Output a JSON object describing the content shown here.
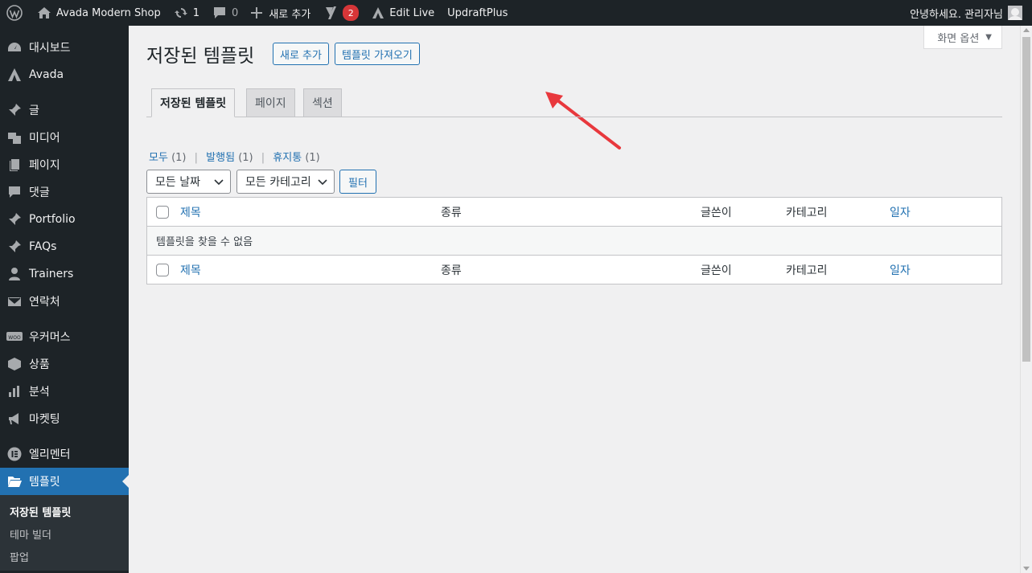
{
  "adminbar": {
    "site_name": "Avada Modern Shop",
    "updates_count": "1",
    "comments_count": "0",
    "new_label": "새로 추가",
    "yoast_badge": "2",
    "edit_live": "Edit Live",
    "updraft": "UpdraftPlus",
    "greeting": "안녕하세요. 관리자님"
  },
  "sidebar": {
    "items": [
      {
        "label": "대시보드",
        "icon": "dashboard-icon"
      },
      {
        "label": "Avada",
        "icon": "avada-icon"
      },
      {
        "label": "글",
        "icon": "pin-icon"
      },
      {
        "label": "미디어",
        "icon": "media-icon"
      },
      {
        "label": "페이지",
        "icon": "page-icon"
      },
      {
        "label": "댓글",
        "icon": "comment-icon"
      },
      {
        "label": "Portfolio",
        "icon": "pin-icon"
      },
      {
        "label": "FAQs",
        "icon": "pin-icon"
      },
      {
        "label": "Trainers",
        "icon": "user-icon"
      },
      {
        "label": "연락처",
        "icon": "mail-icon"
      },
      {
        "label": "우커머스",
        "icon": "woo-icon"
      },
      {
        "label": "상품",
        "icon": "box-icon"
      },
      {
        "label": "분석",
        "icon": "chart-icon"
      },
      {
        "label": "마켓팅",
        "icon": "megaphone-icon"
      },
      {
        "label": "엘리멘터",
        "icon": "elementor-icon"
      },
      {
        "label": "템플릿",
        "icon": "folder-icon"
      }
    ],
    "submenu": [
      "저장된 템플릿",
      "테마 빌더",
      "팝업"
    ]
  },
  "screen_options": "화면 옵션",
  "page": {
    "title": "저장된 템플릿",
    "add_new": "새로 추가",
    "import": "템플릿 가져오기"
  },
  "tabs": [
    "저장된 템플릿",
    "페이지",
    "섹션"
  ],
  "views": {
    "all": "모두",
    "all_count": "(1)",
    "published": "발행됨",
    "published_count": "(1)",
    "trash": "휴지통",
    "trash_count": "(1)"
  },
  "filters": {
    "date": "모든 날짜",
    "category": "모든 카테고리",
    "button": "필터"
  },
  "table": {
    "columns": [
      "제목",
      "종류",
      "글쓴이",
      "카테고리",
      "일자"
    ],
    "empty_message": "템플릿을 찾을 수 없음"
  },
  "colors": {
    "admin_dark": "#1d2327",
    "accent": "#2271b1",
    "badge": "#d63638",
    "annotation_arrow": "#e8383d"
  }
}
